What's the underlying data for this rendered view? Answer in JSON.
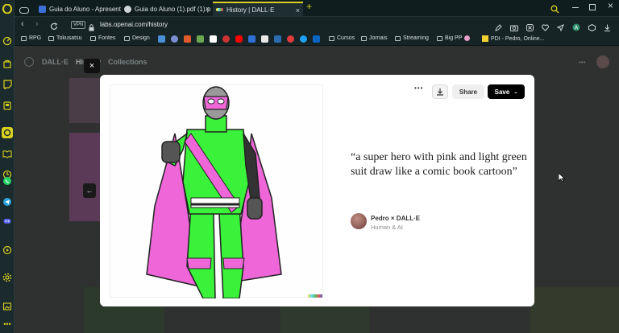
{
  "browser": {
    "tabs": [
      {
        "label": "Guia do Aluno - Apresenta",
        "favicon_color": "#3d6fd8"
      },
      {
        "label": "Guia do Aluno (1).pdf (1).p",
        "favicon_color": "#cfd6d8"
      },
      {
        "label": "History | DALL·E",
        "favicon_color": "#d8c93a"
      }
    ],
    "new_tab_symbol": "+",
    "close_symbol": "×",
    "url": "labs.openai.com/history",
    "vpn_label": "VPN",
    "accent": "#d9d11f"
  },
  "bookmarks": [
    {
      "label": "RPG",
      "type": "folder"
    },
    {
      "label": "Tokusatsu",
      "type": "folder"
    },
    {
      "label": "Fontes",
      "type": "folder"
    },
    {
      "label": "Design",
      "type": "folder"
    },
    {
      "label": "Cursos",
      "type": "folder"
    },
    {
      "label": "Jornais",
      "type": "folder"
    },
    {
      "label": "Streaming",
      "type": "folder"
    },
    {
      "label": "Big PP",
      "type": "folder"
    },
    {
      "label": "PDI - Pedro, Online...",
      "type": "link"
    }
  ],
  "bookmark_icon_colors": [
    "#4a90d9",
    "#7b8fd0",
    "#e05a2b",
    "#6aa84f",
    "#ffffff",
    "#cc3333",
    "#ff0000",
    "#2d6fd4",
    "#e8e8e8",
    "#2b6cb0",
    "#e23c3c",
    "#1da1f2",
    "#0a66c2"
  ],
  "app": {
    "nav": [
      "DALL·E",
      "History",
      "Collections"
    ]
  },
  "modal": {
    "close_symbol": "×",
    "more_symbol": "•••",
    "share_label": "Share",
    "save_label": "Save",
    "prompt": "“a super hero with pink and light green suit draw like a comic book cartoon”",
    "author": "Pedro × DALL·E",
    "credit": "Human & AI",
    "prev_symbol": "←"
  },
  "colors": {
    "suit_green": "#39f239",
    "suit_pink": "#ee66d8",
    "save_bg": "#000000"
  }
}
